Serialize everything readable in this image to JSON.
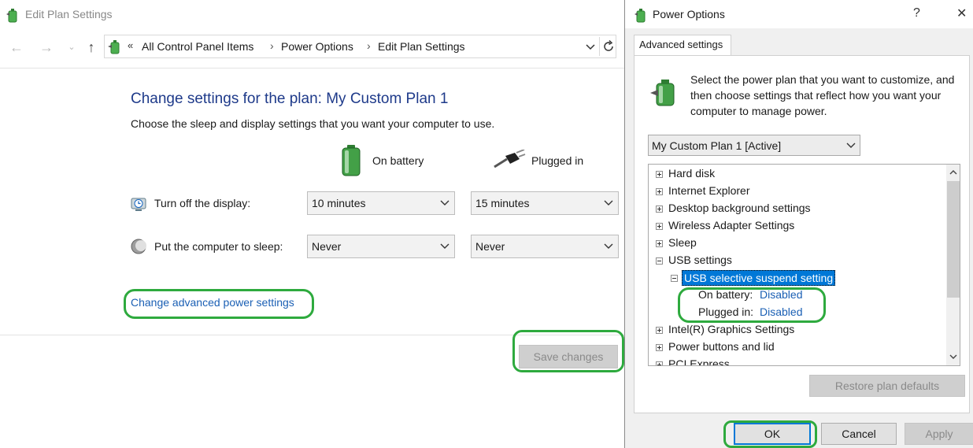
{
  "edit_plan_window": {
    "title": "Edit Plan Settings",
    "nav": {
      "back_icon": "back-arrow-icon",
      "forward_icon": "forward-arrow-icon",
      "recent_icon": "chevron-down-icon",
      "up_icon": "up-arrow-icon"
    },
    "address_bar": {
      "chevrons": "«",
      "crumbs": [
        "All Control Panel Items",
        "Power Options",
        "Edit Plan Settings"
      ],
      "separator": "›"
    },
    "heading": "Change settings for the plan: My Custom Plan 1",
    "subtext": "Choose the sleep and display settings that you want your computer to use.",
    "columns": {
      "battery": "On battery",
      "plugged": "Plugged in"
    },
    "rows": [
      {
        "label": "Turn off the display:",
        "battery": "10 minutes",
        "plugged": "15 minutes"
      },
      {
        "label": "Put the computer to sleep:",
        "battery": "Never",
        "plugged": "Never"
      }
    ],
    "advanced_link": "Change advanced power settings",
    "save_button": "Save changes"
  },
  "power_options_dialog": {
    "title": "Power Options",
    "help": "?",
    "close": "✕",
    "tab": "Advanced settings",
    "intro": "Select the power plan that you want to customize, and then choose settings that reflect how you want your computer to manage power.",
    "plan_combo": "My Custom Plan 1 [Active]",
    "tree": {
      "items_top": [
        "Hard disk",
        "Internet Explorer",
        "Desktop background settings",
        "Wireless Adapter Settings",
        "Sleep"
      ],
      "usb_group": "USB settings",
      "usb_selected": "USB selective suspend setting",
      "on_battery_label": "On battery:",
      "on_battery_value": "Disabled",
      "plugged_in_label": "Plugged in:",
      "plugged_in_value": "Disabled",
      "items_bottom": [
        "Intel(R) Graphics Settings",
        "Power buttons and lid",
        "PCI Express"
      ]
    },
    "restore_button": "Restore plan defaults",
    "ok_button": "OK",
    "cancel_button": "Cancel",
    "apply_button": "Apply"
  },
  "colors": {
    "highlight": "#2eaa3e",
    "link": "#1a5fb4",
    "heading": "#1e3a8a",
    "selection": "#0078d7"
  }
}
